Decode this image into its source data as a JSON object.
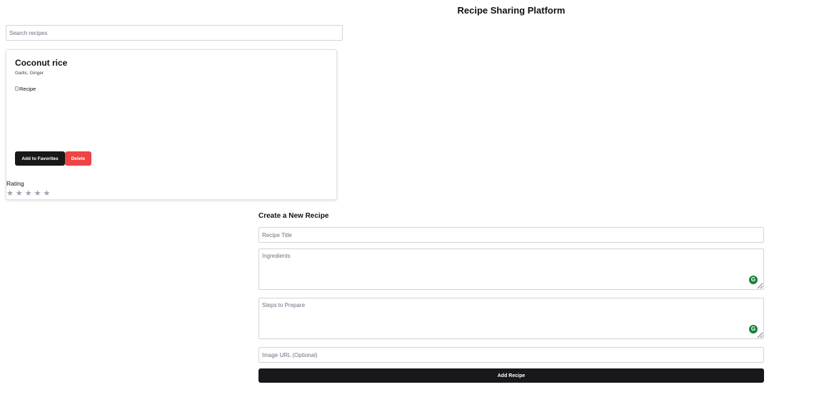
{
  "header": {
    "title": "Recipe Sharing Platform"
  },
  "search": {
    "placeholder": "Search recipes",
    "value": ""
  },
  "recipe_card": {
    "title": "Coconut rice",
    "ingredients": "Garlic, Ginger",
    "image_alt": "Recipe",
    "favorite_label": "Add to Favorites",
    "delete_label": "Delete",
    "rating_label": "Rating",
    "stars": [
      "★",
      "★",
      "★",
      "★",
      "★"
    ],
    "rating_value": 0,
    "star_inactive_color": "#9ca3af"
  },
  "create_form": {
    "heading": "Create a New Recipe",
    "title_placeholder": "Recipe Title",
    "ingredients_placeholder": "Ingredients",
    "steps_placeholder": "Steps to Prepare",
    "image_placeholder": "Image URL (Optional)",
    "submit_label": "Add Recipe"
  },
  "colors": {
    "primary": "#18181b",
    "danger": "#ef4444",
    "grammar_badge": "#15803d"
  }
}
